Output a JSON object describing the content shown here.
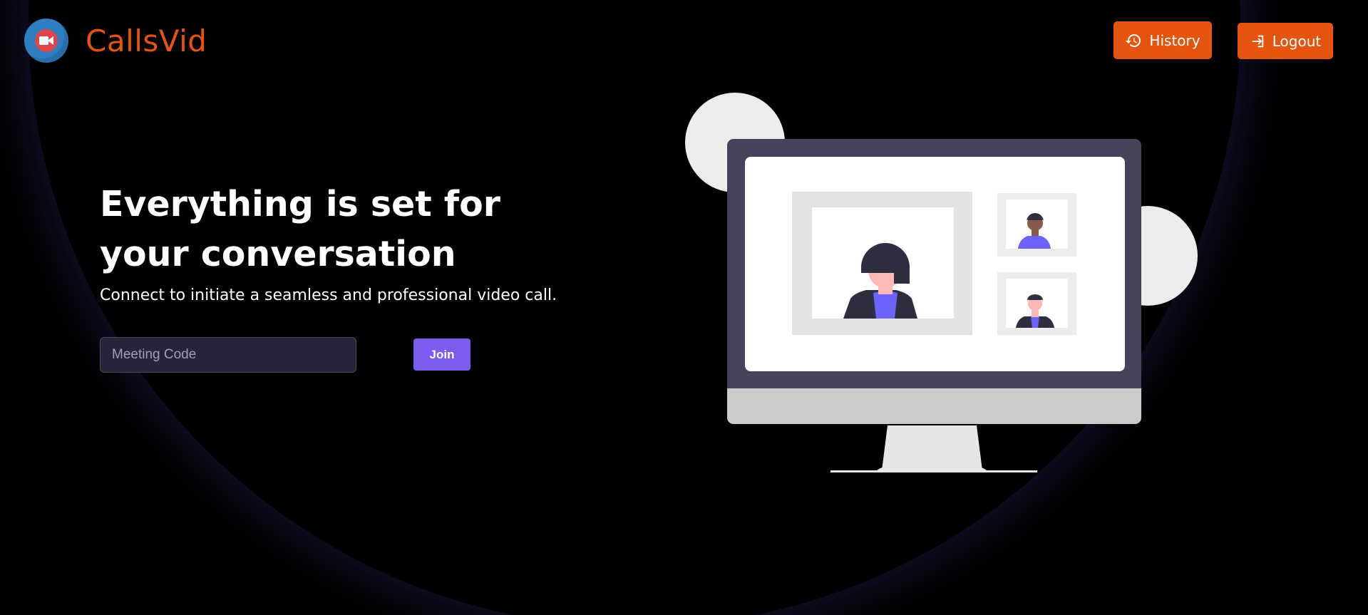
{
  "app": {
    "brand_name": "CallsVid",
    "logo_icon": "video-camera-icon",
    "brand_color": "#e5540f"
  },
  "header": {
    "history_label": "History",
    "history_icon": "history-icon",
    "logout_label": "Logout",
    "logout_icon": "login-icon"
  },
  "hero": {
    "title": "Everything is set for your conversation",
    "subtitle": "Connect to initiate a seamless and professional video call."
  },
  "meeting": {
    "placeholder": "Meeting Code",
    "value": "",
    "join_label": "Join",
    "join_color": "#7c5cf0"
  },
  "illustration": {
    "name": "video-call-monitor-illustration"
  }
}
